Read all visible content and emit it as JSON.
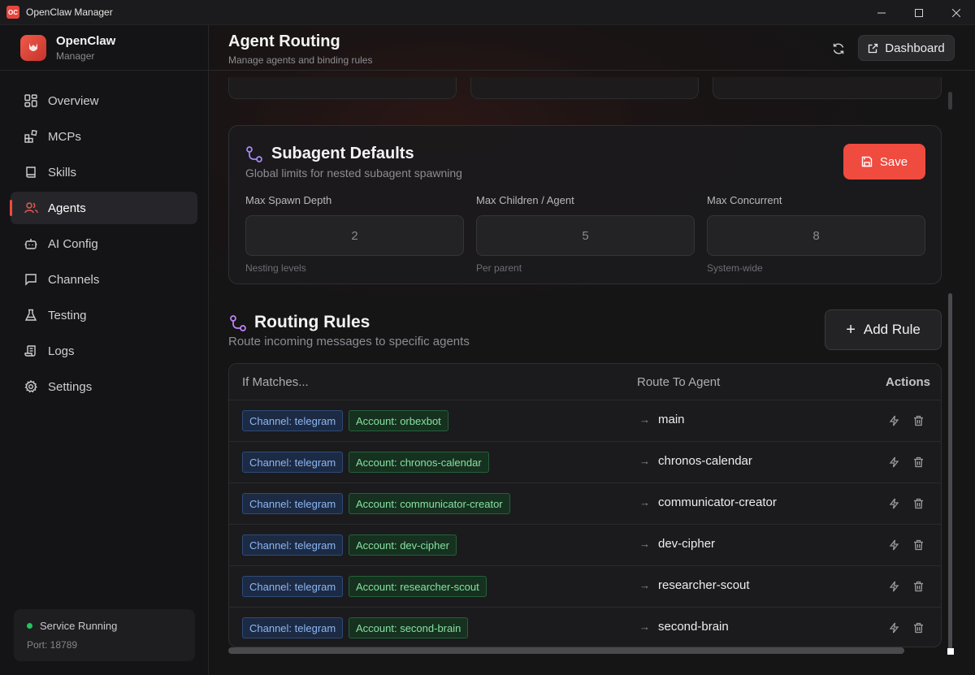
{
  "window": {
    "title": "OpenClaw Manager",
    "icon_text": "OC"
  },
  "brand": {
    "name": "OpenClaw",
    "sub": "Manager"
  },
  "nav": [
    {
      "label": "Overview",
      "icon": "grid-icon"
    },
    {
      "label": "MCPs",
      "icon": "blocks-icon"
    },
    {
      "label": "Skills",
      "icon": "book-icon"
    },
    {
      "label": "Agents",
      "icon": "users-icon",
      "active": true
    },
    {
      "label": "AI Config",
      "icon": "bot-icon"
    },
    {
      "label": "Channels",
      "icon": "message-icon"
    },
    {
      "label": "Testing",
      "icon": "flask-icon"
    },
    {
      "label": "Logs",
      "icon": "scroll-icon"
    },
    {
      "label": "Settings",
      "icon": "gear-icon"
    }
  ],
  "status": {
    "text": "Service Running",
    "port": "Port: 18789",
    "color": "#22c55e"
  },
  "header": {
    "title": "Agent Routing",
    "subtitle": "Manage agents and binding rules",
    "dashboard_label": "Dashboard"
  },
  "subagent": {
    "title": "Subagent Defaults",
    "subtitle": "Global limits for nested subagent spawning",
    "save_label": "Save",
    "fields": [
      {
        "label": "Max Spawn Depth",
        "value": "2",
        "hint": "Nesting levels"
      },
      {
        "label": "Max Children / Agent",
        "value": "5",
        "hint": "Per parent"
      },
      {
        "label": "Max Concurrent",
        "value": "8",
        "hint": "System-wide"
      }
    ]
  },
  "routing": {
    "title": "Routing Rules",
    "subtitle": "Route incoming messages to specific agents",
    "add_label": "Add Rule",
    "columns": {
      "match": "If Matches...",
      "route": "Route To Agent",
      "actions": "Actions"
    },
    "rows": [
      {
        "channel": "Channel: telegram",
        "account": "Account: orbexbot",
        "agent": "main"
      },
      {
        "channel": "Channel: telegram",
        "account": "Account: chronos-calendar",
        "agent": "chronos-calendar"
      },
      {
        "channel": "Channel: telegram",
        "account": "Account: communicator-creator",
        "agent": "communicator-creator"
      },
      {
        "channel": "Channel: telegram",
        "account": "Account: dev-cipher",
        "agent": "dev-cipher"
      },
      {
        "channel": "Channel: telegram",
        "account": "Account: researcher-scout",
        "agent": "researcher-scout"
      },
      {
        "channel": "Channel: telegram",
        "account": "Account: second-brain",
        "agent": "second-brain"
      }
    ]
  },
  "colors": {
    "accent": "#ef4b3f",
    "channel_badge": "#8db7f2",
    "account_badge": "#86e0a0"
  }
}
